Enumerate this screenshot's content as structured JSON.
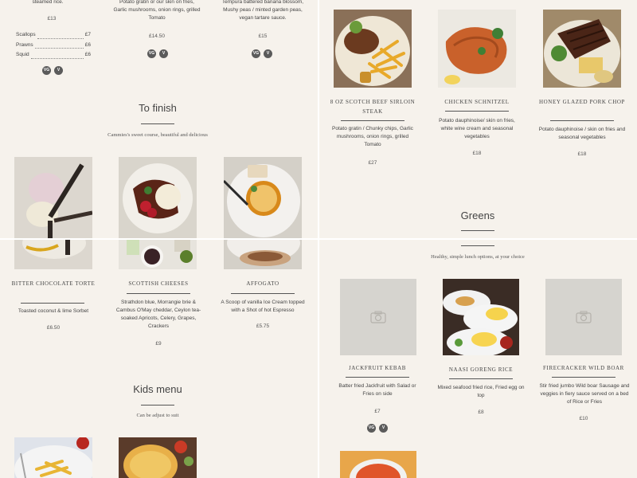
{
  "top_left": {
    "carry_text_1": "steamed rice.",
    "carry_price_1": "£13",
    "carry_text_2": "Potato gratin or our skin on fries, Garlic mushrooms, onion rings, grilled Tomato",
    "carry_price_2": "£14.50",
    "carry_text_3": "Tempura battered banana blossom, Mushy peas / minted garden peas, vegan tartare sauce.",
    "carry_price_3": "£15",
    "seafood": [
      {
        "name": "Scallops",
        "price": "£7"
      },
      {
        "name": "Prawns",
        "price": "£6"
      },
      {
        "name": "Squid",
        "price": "£6"
      }
    ],
    "badges": [
      "VG",
      "V"
    ],
    "to_finish": {
      "heading": "To finish",
      "subtitle": "Cammies's sweet course, beautiful and delicious"
    }
  },
  "top_right": {
    "dishes": [
      {
        "title": "8 OZ SCOTCH BEEF SIRLOIN STEAK",
        "desc": "Potato gratin / Chunky chips, Garlic mushrooms, onion rings, grilled Tomato",
        "price": "£27"
      },
      {
        "title": "CHICKEN SCHNITZEL",
        "desc": "Potato dauphinoise/ skin on fries, white wine cream and seasonal vegetables",
        "price": "£18"
      },
      {
        "title": "HONEY GLAZED PORK CHOP",
        "desc": "Potato dauphinoise / skin on fries and seasonal vegetables",
        "price": "£18"
      }
    ],
    "greens_heading": "Greens"
  },
  "bottom_left": {
    "desserts": [
      {
        "title": "BITTER CHOCOLATE TORTE",
        "desc": "Toasted coconut & lime Sorbet",
        "price": "£6.50"
      },
      {
        "title": "SCOTTISH CHEESES",
        "desc": "Strathdon blue, Morrangie brie & Cambus O'May cheddar, Ceylon tea-soaked Apricots, Celery, Grapes, Crackers",
        "price": "£9"
      },
      {
        "title": "AFFOGATO",
        "desc": "A Scoop of vanilla Ice Cream topped with a Shot of hot Espresso",
        "price": "£5.75"
      }
    ],
    "kids": {
      "heading": "Kids menu",
      "subtitle": "Can be adjust to suit"
    }
  },
  "bottom_right": {
    "subtitle": "Healthy, simple lunch options, at your choice",
    "dishes": [
      {
        "title": "JACKFRUIT KEBAB",
        "desc": "Batter fried Jackfruit with Salad or Fries on side",
        "price": "£7"
      },
      {
        "title": "NAASI GORENG RICE",
        "desc": "Mixed seafood fried rice, Fried egg on top",
        "price": "£8"
      },
      {
        "title": "FIRECRACKER WILD BOAR",
        "desc": "Stir fried jumbo Wild boar Sausage and veggies in fiery sauce served on a bed of Rice or Fries",
        "price": "£10"
      }
    ],
    "badges": [
      "VG",
      "V"
    ]
  },
  "icons": {
    "placeholder": "camera-icon"
  },
  "colors": {
    "background": "#f6f2ec",
    "text": "#3a3a3a",
    "badge": "#5b5b5b",
    "placeholder": "#d6d4cf"
  }
}
